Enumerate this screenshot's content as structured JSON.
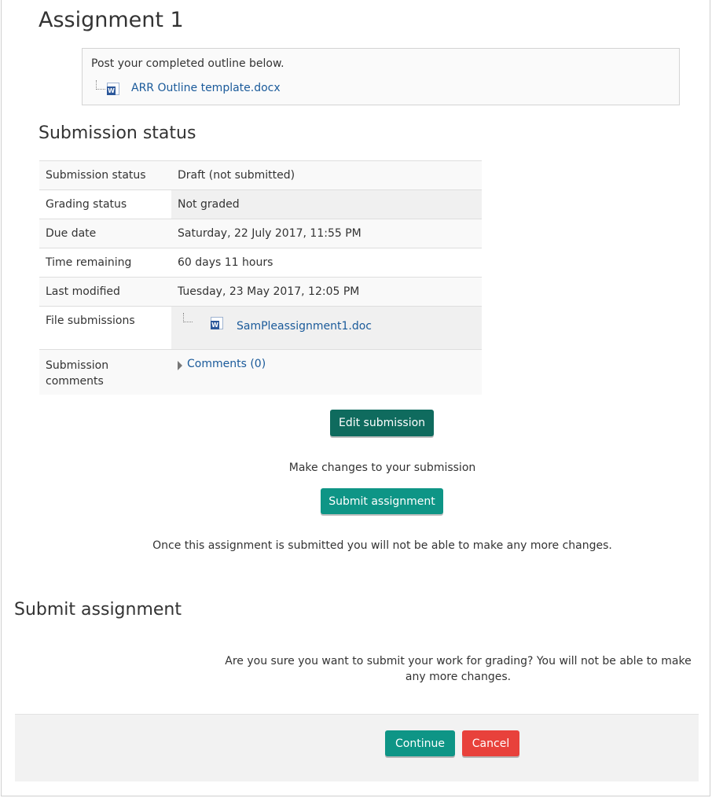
{
  "page": {
    "title": "Assignment 1"
  },
  "intro": {
    "text": "Post your completed outline below.",
    "file_name": "ARR Outline template.docx",
    "file_icon": "word-document-icon"
  },
  "submission_status": {
    "heading": "Submission status",
    "rows": [
      {
        "label": "Submission status",
        "value": "Draft (not submitted)"
      },
      {
        "label": "Grading status",
        "value": "Not graded"
      },
      {
        "label": "Due date",
        "value": "Saturday, 22 July 2017, 11:55 PM"
      },
      {
        "label": "Time remaining",
        "value": "60 days 11 hours"
      },
      {
        "label": "Last modified",
        "value": "Tuesday, 23 May 2017, 12:05 PM"
      },
      {
        "label": "File submissions",
        "file": "SamPleassignment1.doc"
      },
      {
        "label": "Submission comments",
        "comments": "Comments (0)"
      }
    ]
  },
  "actions": {
    "edit_label": "Edit submission",
    "edit_hint": "Make changes to your submission",
    "submit_label": "Submit assignment",
    "submit_hint": "Once this assignment is submitted you will not be able to make any more changes."
  },
  "confirm": {
    "heading": "Submit assignment",
    "message": "Are you sure you want to submit your work for grading? You will not be able to make any more changes.",
    "continue_label": "Continue",
    "cancel_label": "Cancel"
  },
  "colors": {
    "edit_button": "#0f6b5e",
    "submit_button": "#0e9586",
    "cancel_button": "#e8413b",
    "link": "#1a5a9a"
  }
}
